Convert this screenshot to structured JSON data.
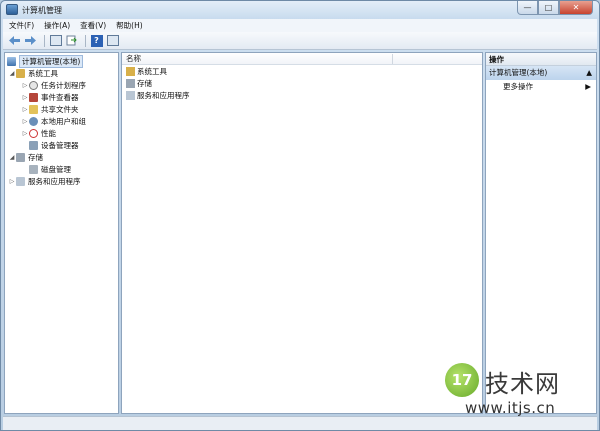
{
  "window": {
    "title": "计算机管理",
    "buttons": {
      "minimize": "—",
      "maximize": "□",
      "close": "✕"
    }
  },
  "menubar": [
    "文件(F)",
    "操作(A)",
    "查看(V)",
    "帮助(H)"
  ],
  "toolbar": {
    "icons": [
      "back-arrow-icon",
      "forward-arrow-icon",
      "show-hide-console-tree-icon",
      "export-list-icon",
      "help-icon",
      "show-hide-action-pane-icon"
    ],
    "help_label": "?"
  },
  "tree": {
    "root": "计算机管理(本地)",
    "items": [
      {
        "label": "系统工具",
        "level": 1,
        "expanded": true
      },
      {
        "label": "任务计划程序",
        "level": 2
      },
      {
        "label": "事件查看器",
        "level": 2
      },
      {
        "label": "共享文件夹",
        "level": 2
      },
      {
        "label": "本地用户和组",
        "level": 2
      },
      {
        "label": "性能",
        "level": 2
      },
      {
        "label": "设备管理器",
        "level": 2
      },
      {
        "label": "存储",
        "level": 1,
        "expanded": true
      },
      {
        "label": "磁盘管理",
        "level": 2
      },
      {
        "label": "服务和应用程序",
        "level": 1
      }
    ]
  },
  "center": {
    "column_header": "名称",
    "rows": [
      "系统工具",
      "存储",
      "服务和应用程序"
    ]
  },
  "actions": {
    "header": "操作",
    "section": "计算机管理(本地)",
    "more": "更多操作"
  },
  "watermark": {
    "logo_text": "17",
    "brand": "技术网",
    "url": "www.itjs.cn"
  }
}
